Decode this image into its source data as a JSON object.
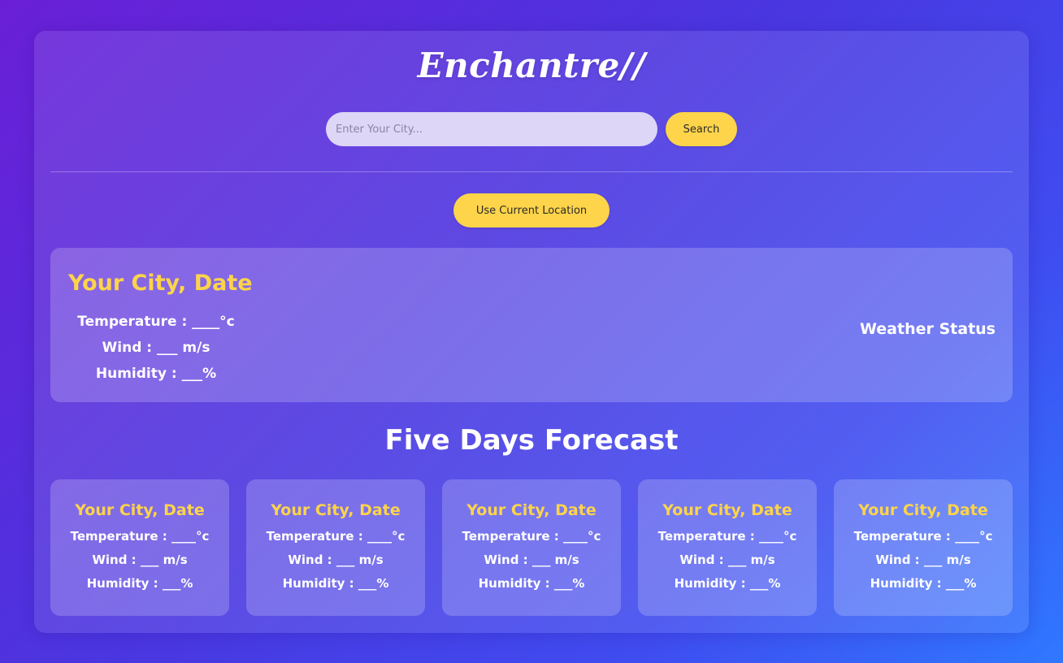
{
  "app": {
    "logo_text": "Enchantre//"
  },
  "search": {
    "placeholder": "Enter Your City...",
    "value": "",
    "button_label": "Search"
  },
  "location": {
    "button_label": "Use Current Location"
  },
  "current": {
    "title": "Your City, Date",
    "temperature": "Temperature : ____°c",
    "wind": "Wind : ___ m/s",
    "humidity": "Humidity : ___%",
    "status": "Weather Status"
  },
  "forecast": {
    "heading": "Five Days Forecast",
    "days": [
      {
        "title": "Your City, Date",
        "temperature": "Temperature : ____°c",
        "wind": "Wind : ___ m/s",
        "humidity": "Humidity : ___%"
      },
      {
        "title": "Your City, Date",
        "temperature": "Temperature : ____°c",
        "wind": "Wind : ___ m/s",
        "humidity": "Humidity : ___%"
      },
      {
        "title": "Your City, Date",
        "temperature": "Temperature : ____°c",
        "wind": "Wind : ___ m/s",
        "humidity": "Humidity : ___%"
      },
      {
        "title": "Your City, Date",
        "temperature": "Temperature : ____°c",
        "wind": "Wind : ___ m/s",
        "humidity": "Humidity : ___%"
      },
      {
        "title": "Your City, Date",
        "temperature": "Temperature : ____°c",
        "wind": "Wind : ___ m/s",
        "humidity": "Humidity : ___%"
      }
    ]
  },
  "colors": {
    "accent_yellow": "#fdd44a",
    "gradient_start": "#6a1fd6",
    "gradient_end": "#2f78ff"
  }
}
